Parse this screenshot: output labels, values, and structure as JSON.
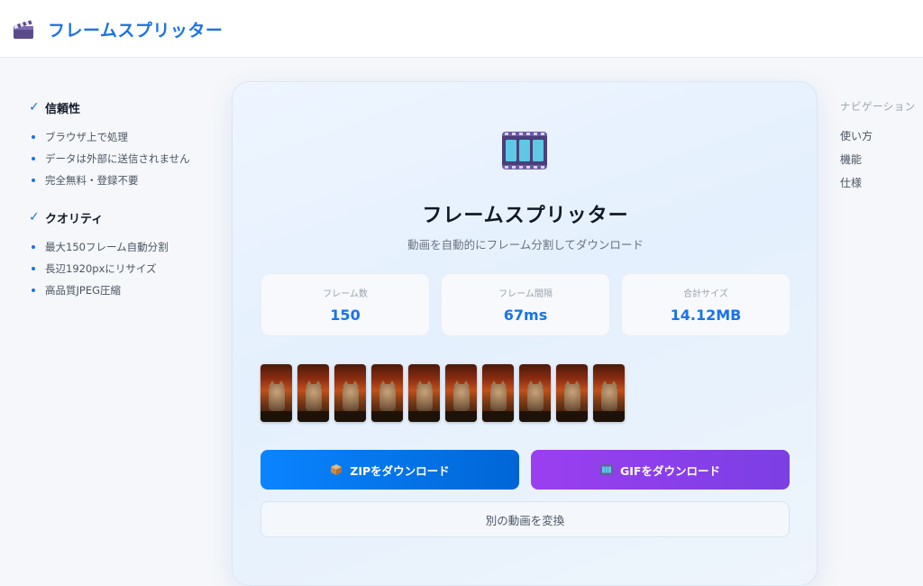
{
  "header": {
    "title": "フレームスプリッター",
    "logo_icon": "clapperboard-icon"
  },
  "left": {
    "sections": [
      {
        "title": "信頼性",
        "items": [
          "ブラウザ上で処理",
          "データは外部に送信されません",
          "完全無料・登録不要"
        ]
      },
      {
        "title": "クオリティ",
        "items": [
          "最大150フレーム自動分割",
          "長辺1920pxにリサイズ",
          "高品質JPEG圧縮"
        ]
      }
    ]
  },
  "nav": {
    "heading": "ナビゲーション",
    "items": [
      "使い方",
      "機能",
      "仕様"
    ]
  },
  "card": {
    "icon": "film-frames-icon",
    "title": "フレームスプリッター",
    "subtitle": "動画を自動的にフレーム分割してダウンロード",
    "stats": [
      {
        "label": "フレーム数",
        "value": "150"
      },
      {
        "label": "フレーム間隔",
        "value": "67ms"
      },
      {
        "label": "合計サイズ",
        "value": "14.12MB"
      }
    ],
    "thumbnail_count": 10,
    "buttons": {
      "zip": "ZIPをダウンロード",
      "gif": "GIFをダウンロード",
      "convert": "別の動画を変換"
    }
  },
  "colors": {
    "accent": "#1a73e8",
    "zip_button": "#0a84ff",
    "gif_button": "#8b3fea"
  }
}
